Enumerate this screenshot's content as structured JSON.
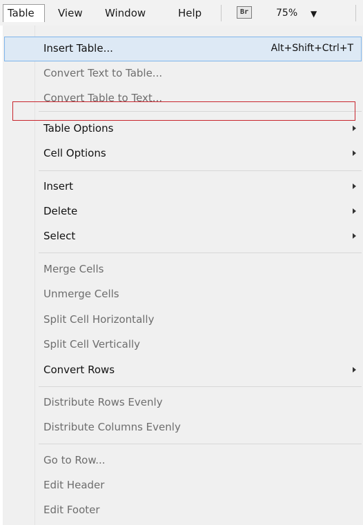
{
  "menubar": {
    "items": [
      "Table",
      "View",
      "Window",
      "Help"
    ],
    "bridge_badge": "Br",
    "zoom": "75%",
    "zoom_arrow": "▼"
  },
  "menu": {
    "insert_table": {
      "label": "Insert Table...",
      "shortcut": "Alt+Shift+Ctrl+T"
    },
    "convert_text_to_table": "Convert Text to Table...",
    "convert_table_to_text": "Convert Table to Text...",
    "table_options": "Table Options",
    "cell_options": "Cell Options",
    "insert": "Insert",
    "delete": "Delete",
    "select": "Select",
    "merge_cells": "Merge Cells",
    "unmerge_cells": "Unmerge Cells",
    "split_cell_horizontally": "Split Cell Horizontally",
    "split_cell_vertically": "Split Cell Vertically",
    "convert_rows": "Convert Rows",
    "distribute_rows_evenly": "Distribute Rows Evenly",
    "distribute_columns_evenly": "Distribute Columns Evenly",
    "go_to_row": "Go to Row...",
    "edit_header": "Edit Header",
    "edit_footer": "Edit Footer"
  },
  "colors": {
    "highlight": "#dde9f5",
    "highlight_border": "#7eb4ea",
    "annotation_box": "#c8242c",
    "disabled_text": "#6d6d6d"
  }
}
